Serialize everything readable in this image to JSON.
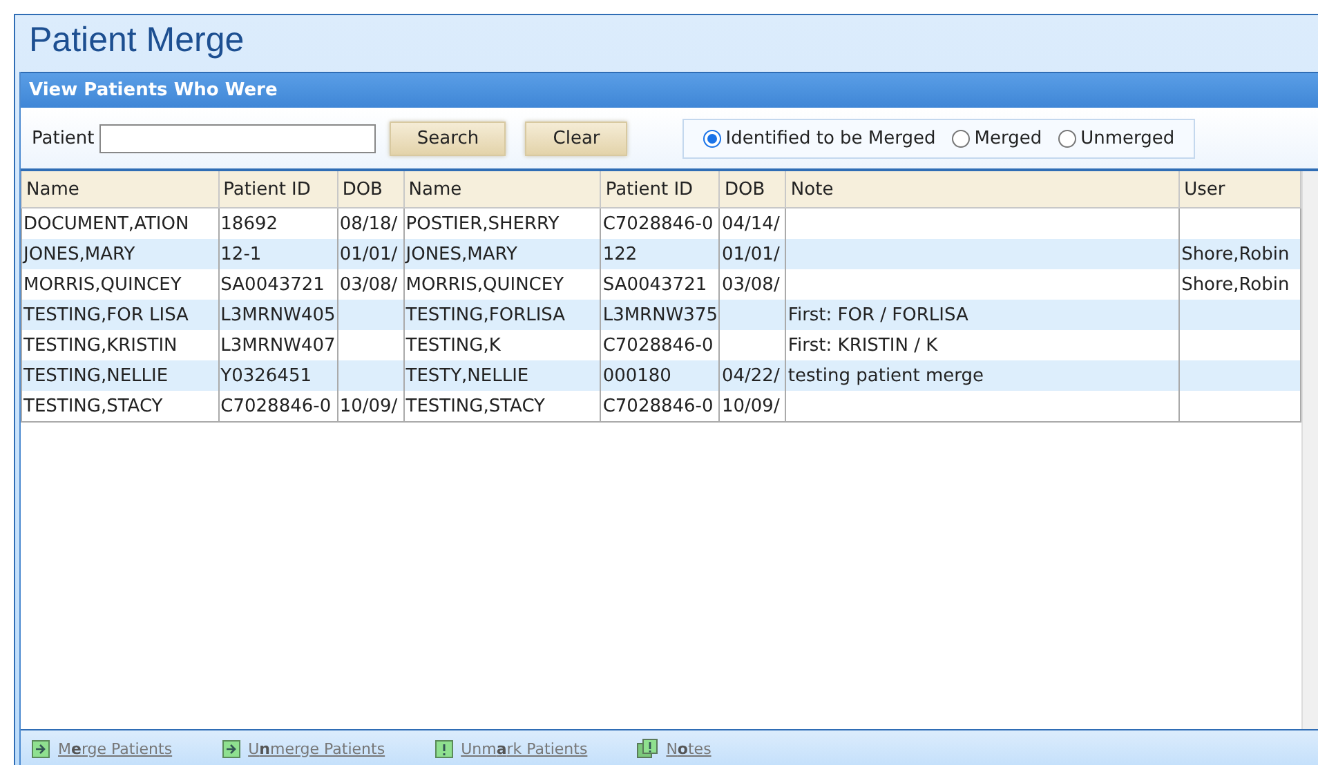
{
  "window": {
    "title": "Patient Merge"
  },
  "section": {
    "title": "View Patients Who Were"
  },
  "search": {
    "label": "Patient",
    "buttons": [
      "Search",
      "Clear"
    ]
  },
  "filter": [
    {
      "label": "Identified to be Merged",
      "selected": true
    },
    {
      "label": "Merged",
      "selected": false
    },
    {
      "label": "Unmerged",
      "selected": false
    }
  ],
  "table": {
    "columns": [
      "Name",
      "Patient ID",
      "DOB",
      "Name",
      "Patient ID",
      "DOB",
      "Note",
      "User"
    ],
    "rows": [
      [
        "DOCUMENT,ATION",
        "18692",
        "08/18/",
        "POSTIER,SHERRY",
        "C7028846-0",
        "04/14/",
        "",
        ""
      ],
      [
        "JONES,MARY",
        "12-1",
        "01/01/",
        "JONES,MARY",
        "122",
        "01/01/",
        "",
        "Shore,Robin"
      ],
      [
        "MORRIS,QUINCEY",
        "SA0043721",
        "03/08/",
        "MORRIS,QUINCEY",
        "SA0043721",
        "03/08/",
        "",
        "Shore,Robin"
      ],
      [
        "TESTING,FOR LISA",
        "L3MRNW405",
        "",
        "TESTING,FORLISA",
        "L3MRNW375",
        "",
        "First: FOR / FORLISA",
        ""
      ],
      [
        "TESTING,KRISTIN",
        "L3MRNW407",
        "",
        "TESTING,K",
        "C7028846-0",
        "",
        "First: KRISTIN / K",
        ""
      ],
      [
        "TESTING,NELLIE",
        "Y0326451",
        "",
        "TESTY,NELLIE",
        "000180",
        "04/22/",
        "testing patient merge",
        ""
      ],
      [
        "TESTING,STACY",
        "C7028846-0",
        "10/09/",
        "TESTING,STACY",
        "C7028846-0",
        "10/09/",
        "",
        ""
      ]
    ]
  },
  "actions": [
    {
      "label": "M**e**rge Patients",
      "kind": "arrow"
    },
    {
      "label": "U**n**merge Patients",
      "kind": "arrow"
    },
    {
      "label": "Unm**a**rk Patients",
      "kind": "alert"
    },
    {
      "label": "N**o**tes",
      "kind": "notes"
    }
  ]
}
